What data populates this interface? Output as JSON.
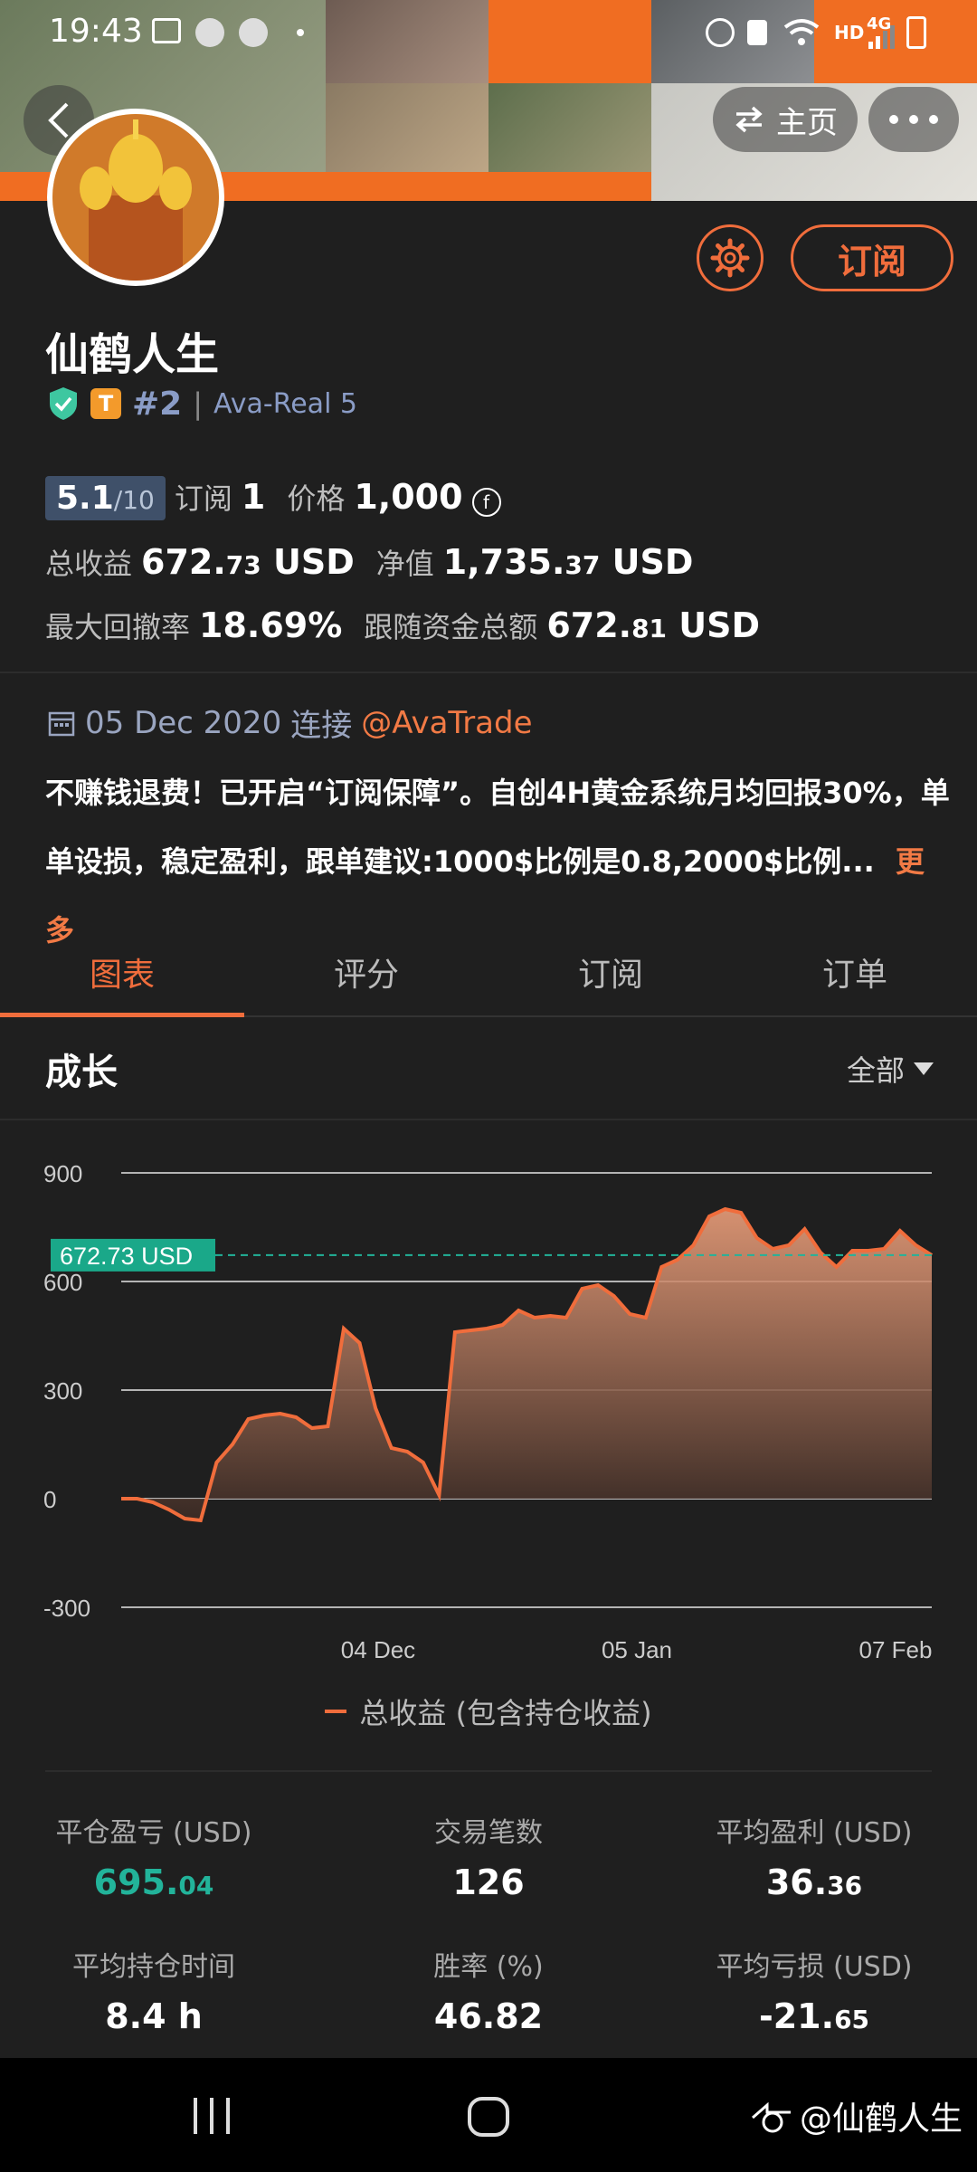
{
  "status_bar": {
    "time": "19:43",
    "network": "HD",
    "network_gen": "4G"
  },
  "header": {
    "home_label": "主页"
  },
  "profile": {
    "name": "仙鹤人生",
    "rank": "#2",
    "account": "Ava-Real 5",
    "subscribe_label": "订阅",
    "score": "5.1",
    "score_max": "/10",
    "subscriptions_label": "订阅",
    "subscriptions": "1",
    "price_label": "价格",
    "price": "1,000",
    "total_profit_label": "总收益",
    "total_profit_main": "672.",
    "total_profit_dec": "73",
    "net_value_label": "净值",
    "net_value_main": "1,735.",
    "net_value_dec": "37",
    "currency": "USD",
    "max_drawdown_label": "最大回撤率",
    "max_drawdown": "18.69%",
    "follower_funds_label": "跟随资金总额",
    "follower_funds_main": "672.",
    "follower_funds_dec": "81",
    "connected_date": "05 Dec 2020",
    "connected_label": "连接",
    "broker": "@AvaTrade",
    "description": "不赚钱退费！已开启“订阅保障”。自创4H黄金系统月均回报30%，单单设损，稳定盈利，跟单建议:1000$比例是0.8,2000$比例...",
    "more_label": "更多"
  },
  "tabs": [
    {
      "label": "图表",
      "active": true
    },
    {
      "label": "评分",
      "active": false
    },
    {
      "label": "订阅",
      "active": false
    },
    {
      "label": "订单",
      "active": false
    }
  ],
  "growth": {
    "title": "成长",
    "range": "全部"
  },
  "chart_data": {
    "type": "area",
    "ylim": [
      -300,
      900
    ],
    "yticks": [
      "900",
      "600",
      "300",
      "0",
      "-300"
    ],
    "ytick_values": [
      900,
      600,
      300,
      0,
      -300
    ],
    "xticks": [
      "04 Dec",
      "05 Jan",
      "07 Feb"
    ],
    "current_label": "672.73 USD",
    "current_value": 672.73,
    "series": [
      {
        "name": "总收益 (包含持仓收益)",
        "values": [
          0,
          0,
          -10,
          -30,
          -55,
          -60,
          100,
          150,
          220,
          230,
          235,
          225,
          195,
          200,
          470,
          430,
          250,
          140,
          130,
          100,
          10,
          460,
          465,
          470,
          480,
          520,
          500,
          505,
          500,
          580,
          590,
          560,
          510,
          500,
          640,
          660,
          700,
          780,
          800,
          790,
          720,
          690,
          700,
          745,
          680,
          640,
          685,
          685,
          690,
          740,
          700,
          672.73
        ]
      }
    ],
    "color": "#f06d3c",
    "legend_label": "总收益 (包含持仓收益)"
  },
  "metrics": [
    {
      "label": "平仓盈亏 (USD)",
      "value_main": "695.",
      "value_dec": "04",
      "color": "green"
    },
    {
      "label": "交易笔数",
      "value_main": "126",
      "value_dec": ""
    },
    {
      "label": "平均盈利 (USD)",
      "value_main": "36.",
      "value_dec": "36"
    },
    {
      "label": "平均持仓时间",
      "value_main": "8.4 h",
      "value_dec": ""
    },
    {
      "label": "胜率 (%)",
      "value_main": "46.82",
      "value_dec": ""
    },
    {
      "label": "平均亏损 (USD)",
      "value_main": "-21.",
      "value_dec": "65"
    }
  ],
  "watermark": "@仙鹤人生"
}
